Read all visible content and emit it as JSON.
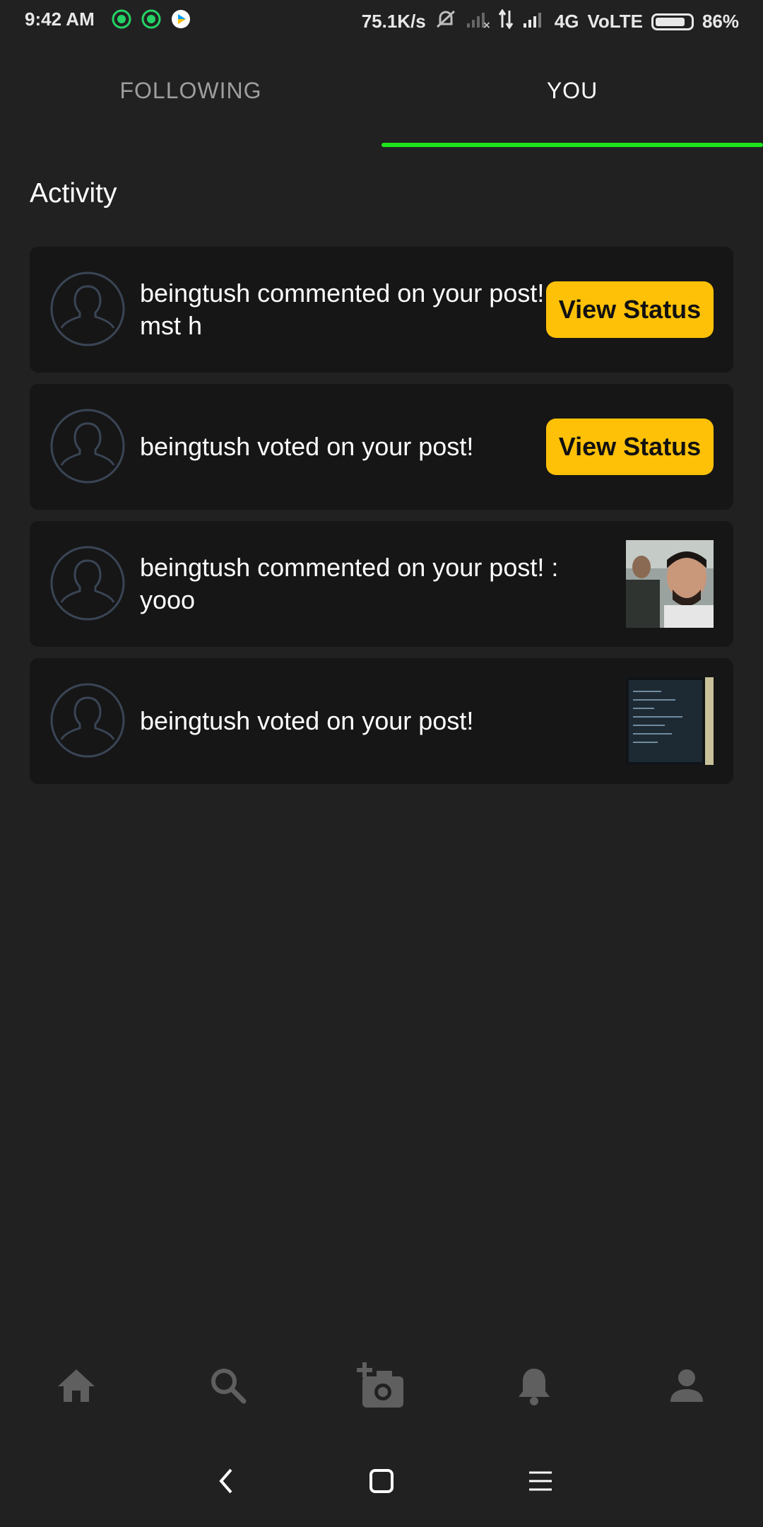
{
  "status_bar": {
    "time": "9:42 AM",
    "net_speed": "75.1K/s",
    "network": "4G",
    "volte": "VoLTE",
    "battery": "86%",
    "battery_level": 0.86,
    "notification_icons": [
      "whatsapp-icon",
      "whatsapp-icon",
      "play-store-icon"
    ]
  },
  "tabs": [
    {
      "label": "FOLLOWING",
      "active": false
    },
    {
      "label": "YOU",
      "active": true
    }
  ],
  "accent_color": "#1ee41e",
  "button_color": "#ffc107",
  "section_title": "Activity",
  "activities": [
    {
      "text": "beingtush commented on your post! : mst h",
      "action": "View Status"
    },
    {
      "text": "beingtush voted on your post!",
      "action": "View Status"
    },
    {
      "text": "beingtush commented on your post! : yooo",
      "thumbnail": "selfie-photo"
    },
    {
      "text": "beingtush voted on your post!",
      "thumbnail": "screen-photo"
    }
  ],
  "bottom_nav": [
    "home-icon",
    "search-icon",
    "add-photo-icon",
    "notifications-icon",
    "profile-icon"
  ],
  "system_nav": [
    "back-icon",
    "home-square-icon",
    "menu-icon"
  ]
}
